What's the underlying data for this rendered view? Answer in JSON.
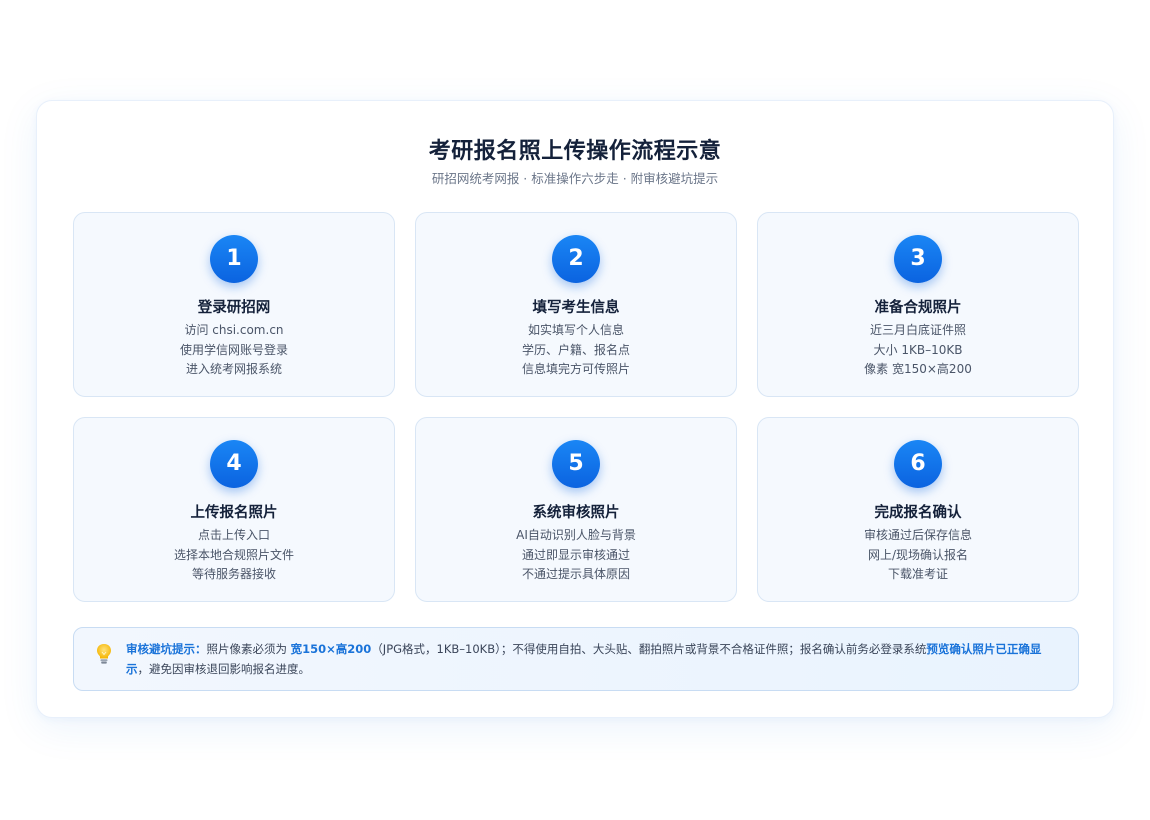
{
  "header": {
    "title": "考研报名照上传操作流程示意",
    "subtitle": "研招网统考网报 · 标准操作六步走 · 附审核避坑提示"
  },
  "steps": [
    {
      "number": "1",
      "title": "登录研招网",
      "lines": [
        "访问 chsi.com.cn",
        "使用学信网账号登录",
        "进入统考网报系统"
      ]
    },
    {
      "number": "2",
      "title": "填写考生信息",
      "lines": [
        "如实填写个人信息",
        "学历、户籍、报名点",
        "信息填完方可传照片"
      ]
    },
    {
      "number": "3",
      "title": "准备合规照片",
      "lines": [
        "近三月白底证件照",
        "大小 1KB–10KB",
        "像素 宽150×高200"
      ]
    },
    {
      "number": "4",
      "title": "上传报名照片",
      "lines": [
        "点击上传入口",
        "选择本地合规照片文件",
        "等待服务器接收"
      ]
    },
    {
      "number": "5",
      "title": "系统审核照片",
      "lines": [
        "AI自动识别人脸与背景",
        "通过即显示审核通过",
        "不通过提示具体原因"
      ]
    },
    {
      "number": "6",
      "title": "完成报名确认",
      "lines": [
        "审核通过后保存信息",
        "网上/现场确认报名",
        "下载准考证"
      ]
    }
  ],
  "tip": {
    "icon": "lightbulb-icon",
    "label": "审核避坑提示：",
    "text1": "照片像素必须为 ",
    "size": "宽150×高200",
    "text2": "（JPG格式，1KB–10KB）；不得使用自拍、大头贴、翻拍照片或背景不合格证件照；报名确认前务必登录系统",
    "emphasis": "预览确认照片已正确显示",
    "text3": "，避免因审核退回影响报名进度。"
  },
  "colors": {
    "accent": "#0b63e0",
    "accent_light": "#1a86f5",
    "card_bg": "#f5f9fe",
    "title": "#14213a",
    "tip_emphasis": "#1a73d9"
  }
}
